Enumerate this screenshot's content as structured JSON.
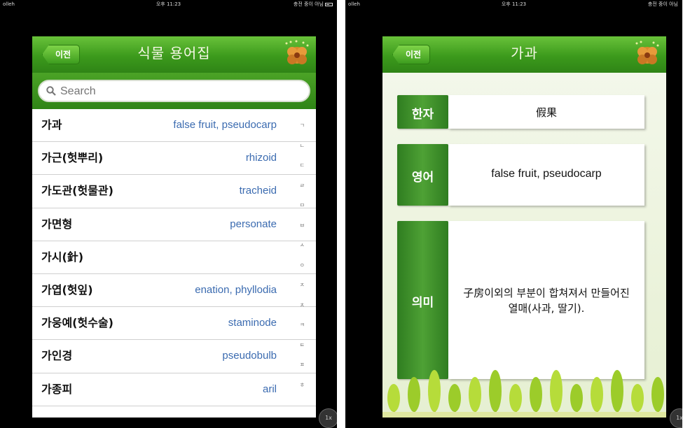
{
  "left": {
    "status": {
      "carrier": "olleh",
      "time": "오후 11:23",
      "charging": "충전 중이 아님"
    },
    "back_label": "이전",
    "title": "식물 용어집",
    "search": {
      "placeholder": "Search"
    },
    "rows": [
      {
        "term": "가과",
        "english": "false fruit, pseudocarp"
      },
      {
        "term": "가근(헛뿌리)",
        "english": "rhizoid"
      },
      {
        "term": "가도관(헛물관)",
        "english": "tracheid"
      },
      {
        "term": "가면형",
        "english": "personate"
      },
      {
        "term": "가시(針)",
        "english": ""
      },
      {
        "term": "가엽(헛잎)",
        "english": "enation, phyllodia"
      },
      {
        "term": "가웅예(헛수술)",
        "english": "staminode"
      },
      {
        "term": "가인경",
        "english": "pseudobulb"
      },
      {
        "term": "가종피",
        "english": "aril"
      }
    ],
    "index_letters": [
      "ㄱ",
      "ㄴ",
      "ㄷ",
      "ㄹ",
      "ㅁ",
      "ㅂ",
      "ㅅ",
      "ㅇ",
      "ㅈ",
      "ㅊ",
      "ㅋ",
      "ㅌ",
      "ㅍ",
      "ㅎ"
    ],
    "zoom": "1x"
  },
  "right": {
    "status": {
      "carrier": "olleh",
      "time": "오후 11:23",
      "charging": "충전 중이 아님"
    },
    "back_label": "이전",
    "title": "가과",
    "fields": [
      {
        "label": "한자",
        "value": "假果"
      },
      {
        "label": "영어",
        "value": "false fruit, pseudocarp"
      },
      {
        "label": "의미",
        "value": "子房이외의 부분이 합쳐져서 만들어진 열매(사과, 딸기)."
      }
    ],
    "zoom": "1x"
  },
  "colors": {
    "nav_green": "#3c9a1c",
    "english_text": "#3b6bb0",
    "label_green": "#2f7d20"
  },
  "icons": [
    "search-icon",
    "flower-logo-icon",
    "battery-icon",
    "wifi-icon",
    "tree-decoration"
  ]
}
